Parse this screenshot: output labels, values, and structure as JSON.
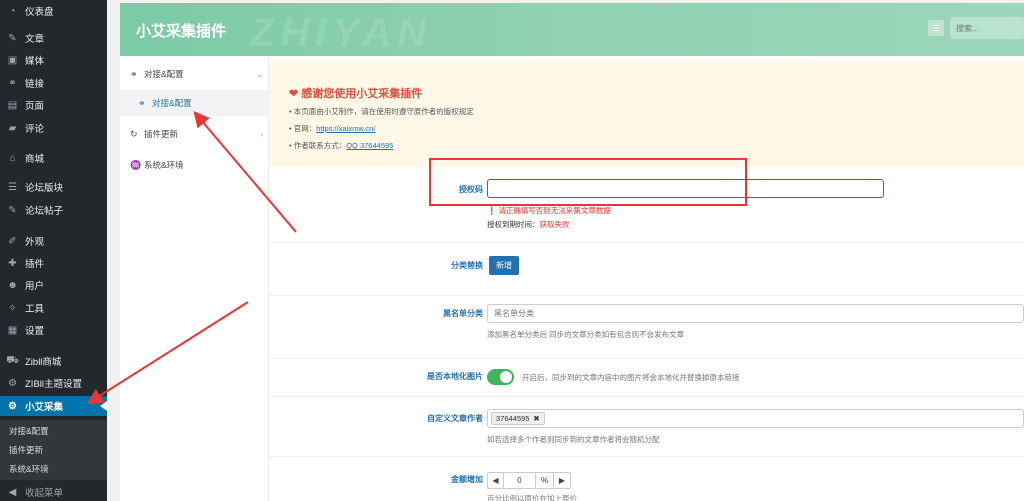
{
  "wp_menu": [
    {
      "label": "仪表盘",
      "icon": "dashboard-icon",
      "glyph": "◔"
    },
    {
      "label": "文章",
      "icon": "pin-icon",
      "glyph": "✎"
    },
    {
      "label": "媒体",
      "icon": "media-icon",
      "glyph": "▣"
    },
    {
      "label": "链接",
      "icon": "link-icon",
      "glyph": "⚭"
    },
    {
      "label": "页面",
      "icon": "page-icon",
      "glyph": "▤"
    },
    {
      "label": "评论",
      "icon": "comment-icon",
      "glyph": "▰"
    },
    {
      "label": "商城",
      "icon": "store-icon",
      "glyph": "⌂"
    },
    {
      "label": "论坛版块",
      "icon": "forum-icon",
      "glyph": "☰"
    },
    {
      "label": "论坛帖子",
      "icon": "topic-icon",
      "glyph": "✎"
    },
    {
      "label": "外观",
      "icon": "appearance-icon",
      "glyph": "✐"
    },
    {
      "label": "插件",
      "icon": "plugin-icon",
      "glyph": "✚"
    },
    {
      "label": "用户",
      "icon": "user-icon",
      "glyph": "☻"
    },
    {
      "label": "工具",
      "icon": "tools-icon",
      "glyph": "✧"
    },
    {
      "label": "设置",
      "icon": "settings-icon",
      "glyph": "▦"
    },
    {
      "label": "Zibll商城",
      "icon": "cart-icon",
      "glyph": "⛟"
    },
    {
      "label": "ZIBll主题设置",
      "icon": "gear-icon",
      "glyph": "⚙"
    },
    {
      "label": "小艾采集",
      "icon": "gear-icon",
      "glyph": "⚙"
    }
  ],
  "wp_submenu": [
    "对接&配置",
    "插件更新",
    "系统&环境"
  ],
  "wp_collapse": "收起菜单",
  "plugin": {
    "title": "小艾采集插件",
    "watermark": "ZHIYAN",
    "search_placeholder": "搜索..."
  },
  "nav": {
    "group1": "对接&配置",
    "group1_sub": "对接&配置",
    "group2": "插件更新",
    "group3": "系统&环境"
  },
  "notice": {
    "title": "感谢您使用小艾采集插件",
    "line1": "本页面由小艾制作，请在使用时遵守原作者的版权规定",
    "site_label": "官网：",
    "site_link": "https://xaixmw.cn/",
    "contact_label": "作者联系方式：",
    "contact_link": "QQ 37644595"
  },
  "fields": {
    "license_label": "授权码",
    "license_error": "请正确填写否则无法采集文章数据",
    "license_expire_label": "授权到期时间：",
    "license_expire_value": "获取失败",
    "category_label": "分类替换",
    "category_button": "新增",
    "blacklist_label": "黑名单分类",
    "blacklist_placeholder": "黑名单分类",
    "blacklist_hint": "添加黑名单分类后 同步的文章分类如有包含则不会发布文章",
    "localize_label": "是否本地化图片",
    "localize_hint": "开启后，同步到的文章内容中的图片将会本地化并替换掉原本链接",
    "author_label": "自定义文章作者",
    "author_tag": "37644595",
    "author_hint": "如若选择多个作者则同步到的文章作者将会随机分配",
    "amount_label": "金额增加",
    "amount_value": "0",
    "amount_unit": "%",
    "amount_hint": "百分比例以原价在加上原价"
  },
  "colors": {
    "wp_sidebar": "#23282d",
    "wp_active": "#0073aa",
    "header_green": "#8fd1b1",
    "link_blue": "#2271b1",
    "annotation_red": "#e33",
    "toggle_green": "#3eb55b"
  }
}
